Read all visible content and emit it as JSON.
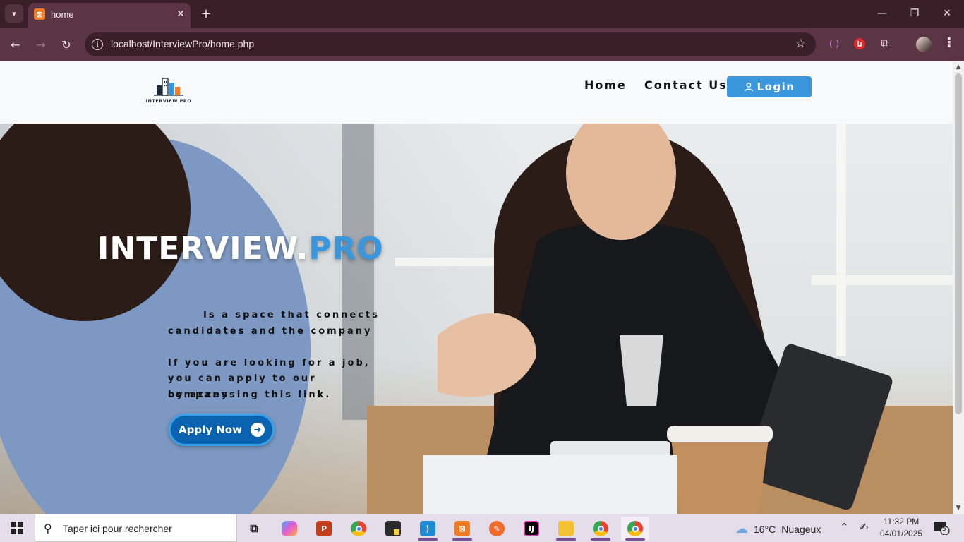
{
  "browser": {
    "tab_title": "home",
    "url": "localhost/InterviewPro/home.php",
    "window_controls": [
      "minimize",
      "restore",
      "close"
    ]
  },
  "site": {
    "logo_text": "INTERVIEW PRO",
    "nav": {
      "home": "Home",
      "contact": "Contact Us",
      "login": "Login"
    },
    "hero": {
      "title_main": "INTERVIEW.",
      "title_accent": "PRO",
      "line1": "Is a space that connects",
      "line2": "candidates and the company",
      "line3": "If you are looking for a job,",
      "line4": "you can apply to our company",
      "line5": "by accessing this link.",
      "apply_button": "Apply Now"
    },
    "accent_color": "#3a96dd"
  },
  "taskbar": {
    "search_placeholder": "Taper ici pour rechercher",
    "weather_temp": "16°C",
    "weather_desc": "Nuageux",
    "time": "11:32 PM",
    "date": "04/01/2025",
    "notification_count": "5",
    "apps": [
      "task-view",
      "copilot",
      "powerpoint",
      "chrome",
      "sticky-notes",
      "vscode",
      "xampp",
      "git-tool",
      "intellij",
      "file-explorer",
      "chrome",
      "chrome"
    ]
  }
}
